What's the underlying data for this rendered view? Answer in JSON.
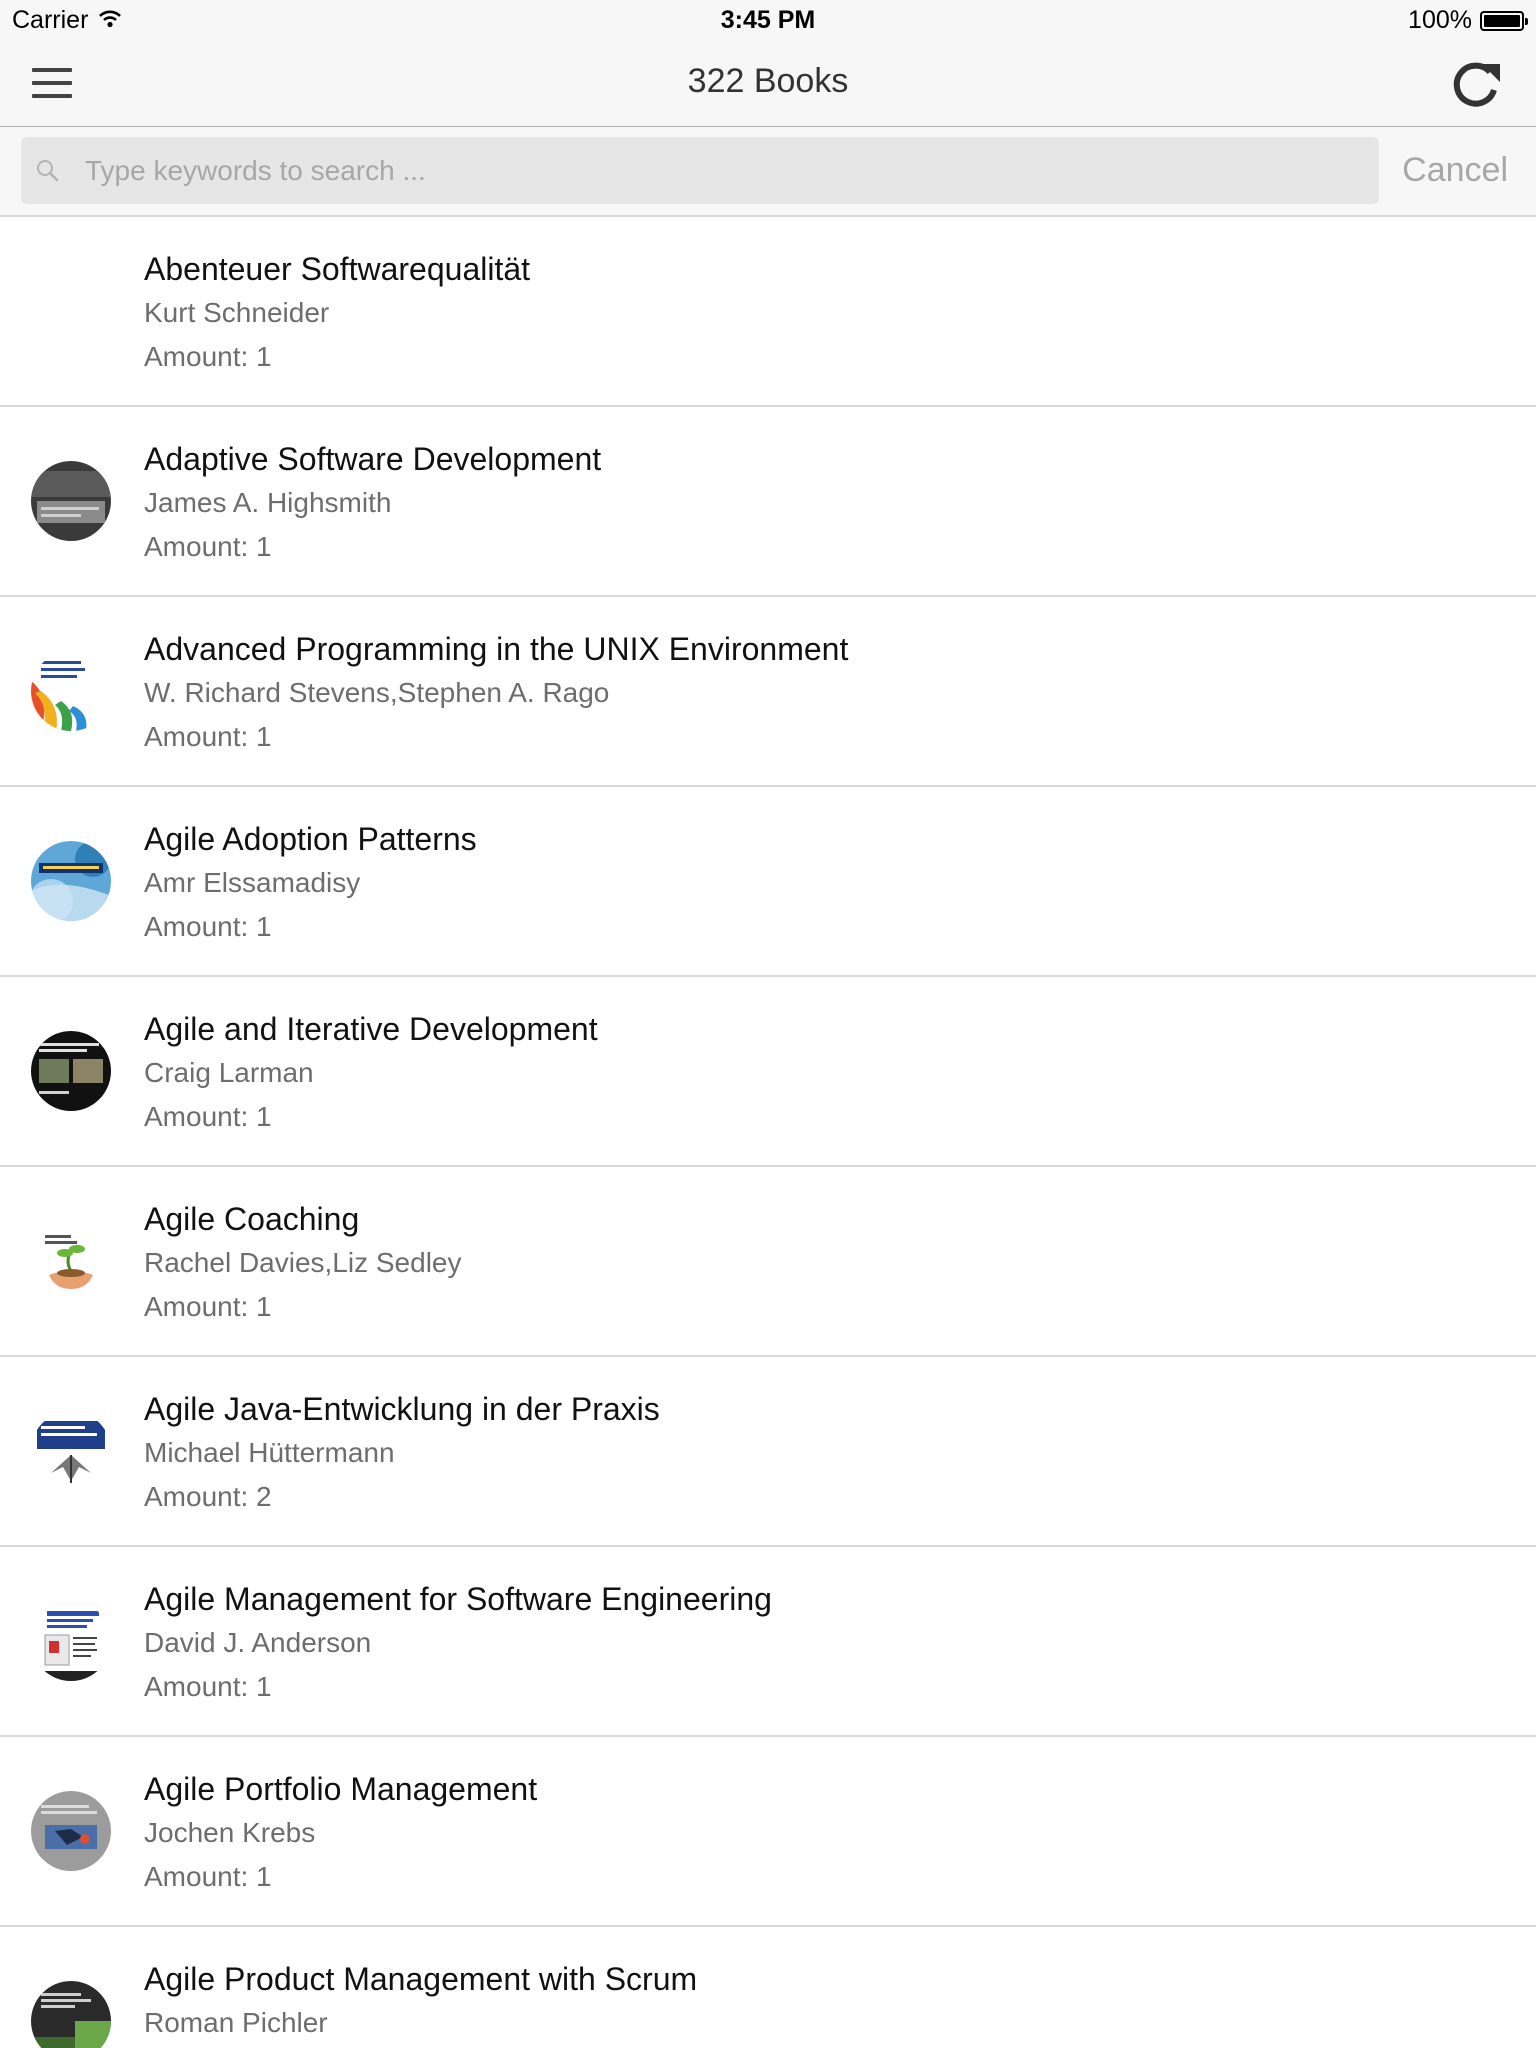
{
  "status_bar": {
    "carrier": "Carrier",
    "time": "3:45 PM",
    "battery": "100%",
    "battery_level": 1.0
  },
  "nav": {
    "title": "322 Books",
    "menu_icon": "hamburger-menu-icon",
    "refresh_icon": "refresh-icon"
  },
  "search": {
    "placeholder": "Type keywords to search ...",
    "value": "",
    "cancel_label": "Cancel",
    "icon": "search-icon"
  },
  "colors": {
    "bar_background": "#f7f7f7",
    "separator": "#d9d9d9",
    "title_text": "#111111",
    "secondary_text": "#6d6d6d",
    "placeholder_text": "#a7a7a7"
  },
  "books": [
    {
      "title": "Abenteuer Softwarequalität",
      "author": "Kurt Schneider",
      "amount": "Amount: 1",
      "has_cover": false
    },
    {
      "title": "Adaptive Software Development",
      "author": "James A. Highsmith",
      "amount": "Amount: 1",
      "has_cover": true
    },
    {
      "title": "Advanced Programming in the UNIX Environment",
      "author": "W. Richard Stevens,Stephen A. Rago",
      "amount": "Amount: 1",
      "has_cover": true
    },
    {
      "title": "Agile Adoption Patterns",
      "author": "Amr Elssamadisy",
      "amount": "Amount: 1",
      "has_cover": true
    },
    {
      "title": "Agile and Iterative Development",
      "author": "Craig Larman",
      "amount": "Amount: 1",
      "has_cover": true
    },
    {
      "title": "Agile Coaching",
      "author": "Rachel Davies,Liz Sedley",
      "amount": "Amount: 1",
      "has_cover": true
    },
    {
      "title": "Agile Java-Entwicklung in der Praxis",
      "author": "Michael Hüttermann",
      "amount": "Amount: 2",
      "has_cover": true
    },
    {
      "title": "Agile Management for Software Engineering",
      "author": "David J. Anderson",
      "amount": "Amount: 1",
      "has_cover": true
    },
    {
      "title": "Agile Portfolio Management",
      "author": "Jochen Krebs",
      "amount": "Amount: 1",
      "has_cover": true
    },
    {
      "title": "Agile Product Management with Scrum",
      "author": "Roman Pichler",
      "amount": "",
      "has_cover": true
    }
  ]
}
